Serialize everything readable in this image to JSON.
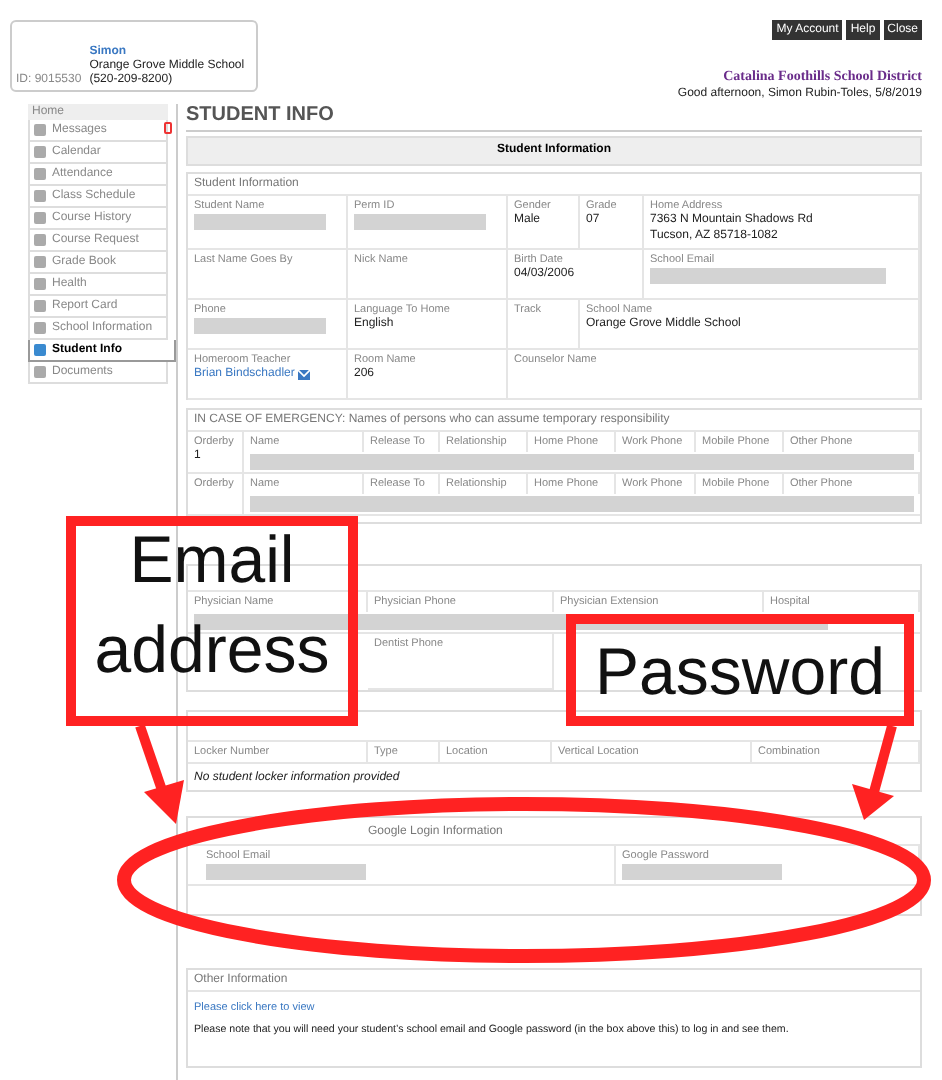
{
  "profile": {
    "name": "Simon",
    "school": "Orange Grove Middle School",
    "id": "ID: 9015530",
    "phone": "(520-209-8200)"
  },
  "top_buttons": [
    "My Account",
    "Help",
    "Close"
  ],
  "district": "Catalina Foothills School District",
  "greeting": "Good afternoon, Simon Rubin-Toles, 5/8/2019",
  "sidebar": {
    "header": "Home",
    "items": [
      {
        "label": "Messages",
        "selected": false,
        "alert": true
      },
      {
        "label": "Calendar",
        "selected": false,
        "alert": false
      },
      {
        "label": "Attendance",
        "selected": false,
        "alert": false
      },
      {
        "label": "Class Schedule",
        "selected": false,
        "alert": false
      },
      {
        "label": "Course History",
        "selected": false,
        "alert": false
      },
      {
        "label": "Course Request",
        "selected": false,
        "alert": false
      },
      {
        "label": "Grade Book",
        "selected": false,
        "alert": false
      },
      {
        "label": "Health",
        "selected": false,
        "alert": false
      },
      {
        "label": "Report Card",
        "selected": false,
        "alert": false
      },
      {
        "label": "School Information",
        "selected": false,
        "alert": false
      },
      {
        "label": "Student Info",
        "selected": true,
        "alert": false
      },
      {
        "label": "Documents",
        "selected": false,
        "alert": false
      }
    ]
  },
  "page_title": "STUDENT INFO",
  "panel_title": "Student Information",
  "student_info": {
    "title": "Student Information",
    "rows": [
      [
        {
          "label": "Student Name",
          "kind": "redacted"
        },
        {
          "label": "Perm ID",
          "kind": "redacted"
        },
        {
          "label": "Gender",
          "kind": "text",
          "lines": [
            "Male"
          ]
        },
        {
          "label": "Grade",
          "kind": "text",
          "lines": [
            "07"
          ]
        },
        {
          "label": "Home Address",
          "kind": "text",
          "lines": [
            "7363 N Mountain Shadows Rd",
            "Tucson, AZ 85718-1082"
          ]
        }
      ],
      [
        {
          "label": "Last Name Goes By",
          "kind": "empty"
        },
        {
          "label": "Nick Name",
          "kind": "empty"
        },
        {
          "label": "Birth Date",
          "kind": "text",
          "lines": [
            "04/03/2006"
          ]
        },
        {
          "label": "School Email",
          "kind": "redacted"
        }
      ],
      [
        {
          "label": "Phone",
          "kind": "redacted"
        },
        {
          "label": "Language To Home",
          "kind": "text",
          "lines": [
            "English"
          ]
        },
        {
          "label": "Track",
          "kind": "empty"
        },
        {
          "label": "School Name",
          "kind": "text",
          "lines": [
            "Orange Grove Middle School"
          ]
        }
      ],
      [
        {
          "label": "Homeroom Teacher",
          "kind": "link",
          "lines": [
            "Brian Bindschadler"
          ]
        },
        {
          "label": "Room Name",
          "kind": "text",
          "lines": [
            "206"
          ]
        },
        {
          "label": "Counselor Name",
          "kind": "empty"
        }
      ]
    ]
  },
  "emergency": {
    "title": "IN CASE OF EMERGENCY: Names of persons who can assume temporary responsibility",
    "rows": [
      {
        "orderby": "Orderby",
        "number": "1",
        "columns": [
          "Name",
          "Release To",
          "Relationship",
          "Home Phone",
          "Work Phone",
          "Mobile Phone",
          "Other Phone"
        ]
      },
      {
        "orderby": "Orderby",
        "columns": [
          "Name",
          "Release To",
          "Relationship",
          "Home Phone",
          "Work Phone",
          "Mobile Phone",
          "Other Phone"
        ]
      }
    ]
  },
  "physician": {
    "row_1": [
      "Physician Name",
      "Physician Phone",
      "Physician Extension",
      "Hospital"
    ],
    "row_2": {
      "column_2": "Dentist Phone"
    }
  },
  "locker": {
    "columns": [
      "Locker Number",
      "Type",
      "Location",
      "Vertical Location",
      "Combination"
    ],
    "message": "No student locker information provided"
  },
  "google_login": {
    "title": "Google Login Information",
    "fields": [
      "School Email",
      "Google Password"
    ]
  },
  "other_info": {
    "title": "Other Information",
    "link": "Please click here to view",
    "note": "Please note that you will need your student’s school email and Google password (in the box above this) to log in and see them."
  },
  "annotations": [
    {
      "lines": [
        "Email",
        "address"
      ]
    },
    {
      "lines": [
        "Password"
      ]
    }
  ]
}
